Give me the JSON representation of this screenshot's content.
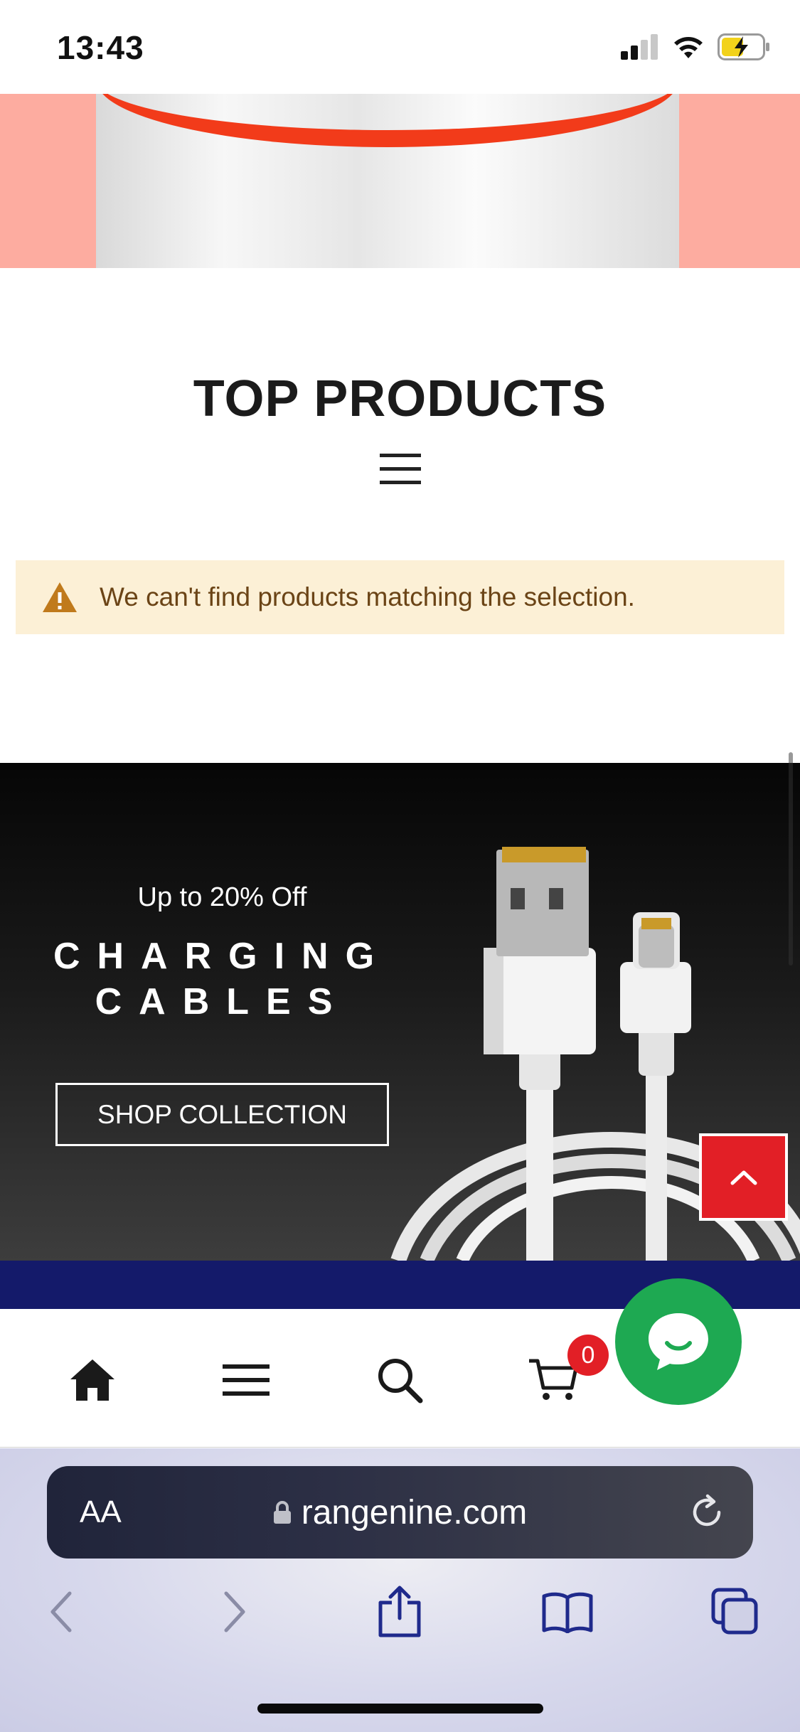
{
  "status_bar": {
    "time": "13:43"
  },
  "colors": {
    "accent_red": "#e21f26",
    "chat_green": "#1ea952",
    "navy": "#141a6a",
    "notice_bg": "#fcf0d6"
  },
  "section": {
    "title": "TOP PRODUCTS",
    "filter_icon": "menu-icon",
    "notice": {
      "icon": "warning-icon",
      "text": "We can't find products matching the selection."
    }
  },
  "banner": {
    "eyebrow": "Up to 20% Off",
    "title_line1": "CHARGING",
    "title_line2": "CABLES",
    "button_label": "SHOP COLLECTION"
  },
  "bottom_nav": {
    "items": [
      {
        "icon": "home-icon"
      },
      {
        "icon": "menu-icon"
      },
      {
        "icon": "search-icon"
      },
      {
        "icon": "cart-icon"
      }
    ],
    "cart_count": "0"
  },
  "safari": {
    "text_size_label": "AA",
    "url": "rangenine.com"
  }
}
